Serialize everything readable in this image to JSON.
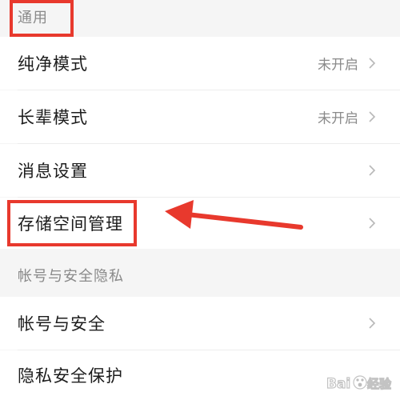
{
  "sections": {
    "general": {
      "title": "通用"
    },
    "account": {
      "title": "帐号与安全隐私"
    }
  },
  "rows": {
    "pure_mode": {
      "label": "纯净模式",
      "value": "未开启"
    },
    "elder_mode": {
      "label": "长辈模式",
      "value": "未开启"
    },
    "message_settings": {
      "label": "消息设置"
    },
    "storage": {
      "label": "存储空间管理"
    },
    "account_security": {
      "label": "帐号与安全"
    },
    "privacy": {
      "label": "隐私安全保护"
    }
  },
  "annotation": {
    "color": "#e8392d"
  },
  "colors": {
    "background": "#f5f5f5",
    "row": "#ffffff",
    "muted_text": "#8a8a8a",
    "accent": "#e8392d"
  },
  "watermark": {
    "text": "Bai 经验"
  }
}
